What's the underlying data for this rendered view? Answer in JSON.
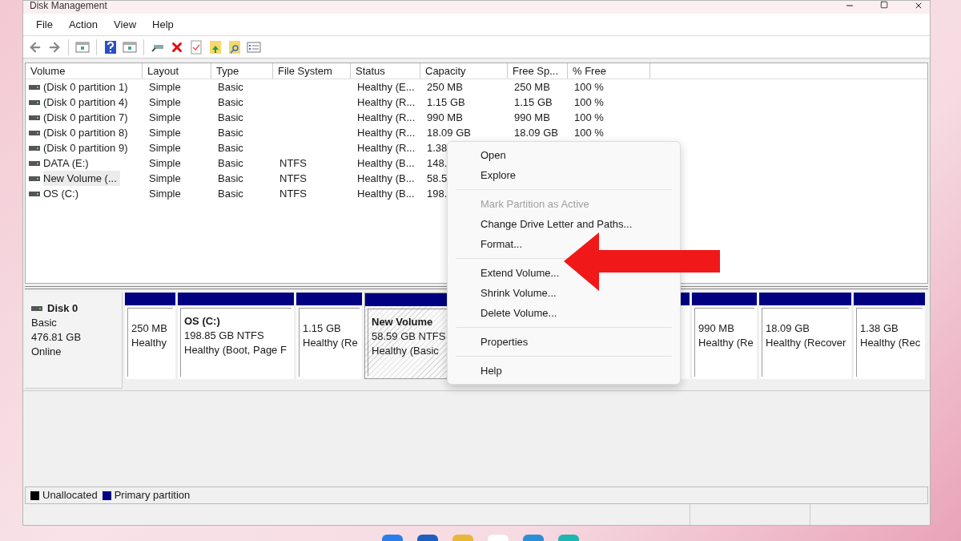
{
  "window": {
    "title": "Disk Management"
  },
  "menubar": [
    "File",
    "Action",
    "View",
    "Help"
  ],
  "table": {
    "columns": [
      "Volume",
      "Layout",
      "Type",
      "File System",
      "Status",
      "Capacity",
      "Free Sp...",
      "% Free"
    ],
    "rows": [
      {
        "selected": false,
        "cells": [
          "(Disk 0 partition 1)",
          "Simple",
          "Basic",
          "",
          "Healthy (E...",
          "250 MB",
          "250 MB",
          "100 %"
        ]
      },
      {
        "selected": false,
        "cells": [
          "(Disk 0 partition 4)",
          "Simple",
          "Basic",
          "",
          "Healthy (R...",
          "1.15 GB",
          "1.15 GB",
          "100 %"
        ]
      },
      {
        "selected": false,
        "cells": [
          "(Disk 0 partition 7)",
          "Simple",
          "Basic",
          "",
          "Healthy (R...",
          "990 MB",
          "990 MB",
          "100 %"
        ]
      },
      {
        "selected": false,
        "cells": [
          "(Disk 0 partition 8)",
          "Simple",
          "Basic",
          "",
          "Healthy (R...",
          "18.09 GB",
          "18.09 GB",
          "100 %"
        ]
      },
      {
        "selected": false,
        "cells": [
          "(Disk 0 partition 9)",
          "Simple",
          "Basic",
          "",
          "Healthy (R...",
          "1.38"
        ]
      },
      {
        "selected": false,
        "cells": [
          "DATA (E:)",
          "Simple",
          "Basic",
          "NTFS",
          "Healthy (B...",
          "148."
        ]
      },
      {
        "selected": true,
        "cells": [
          "New Volume (...",
          "Simple",
          "Basic",
          "NTFS",
          "Healthy (B...",
          "58.5"
        ]
      },
      {
        "selected": false,
        "cells": [
          "OS (C:)",
          "Simple",
          "Basic",
          "NTFS",
          "Healthy (B...",
          "198."
        ]
      }
    ]
  },
  "disk": {
    "name": "Disk 0",
    "lines": [
      "Basic",
      "476.81 GB",
      "Online"
    ],
    "partitions": [
      {
        "selected": false,
        "lines": [
          "250 MB",
          "Healthy"
        ]
      },
      {
        "selected": false,
        "title": "OS  (C:)",
        "lines": [
          "198.85 GB NTFS",
          "Healthy (Boot, Page F"
        ]
      },
      {
        "selected": false,
        "lines": [
          "1.15 GB",
          "Healthy (Re"
        ]
      },
      {
        "selected": true,
        "title": "New Volume",
        "lines": [
          "58.59 GB NTFS",
          "Healthy (Basic"
        ]
      },
      {
        "kind": "covered"
      },
      {
        "kind": "hidden"
      },
      {
        "selected": false,
        "lines": [
          "990 MB",
          "Healthy (Re"
        ]
      },
      {
        "selected": false,
        "lines": [
          "18.09 GB",
          "Healthy (Recover"
        ]
      },
      {
        "selected": false,
        "lines": [
          "1.38 GB",
          "Healthy (Rec"
        ]
      }
    ]
  },
  "legend": [
    {
      "label": "Unallocated",
      "color": "#000000"
    },
    {
      "label": "Primary partition",
      "color": "#000080"
    }
  ],
  "context_menu": [
    {
      "kind": "item",
      "label": "Open",
      "disabled": false
    },
    {
      "kind": "item",
      "label": "Explore",
      "disabled": false
    },
    {
      "kind": "separator"
    },
    {
      "kind": "item",
      "label": "Mark Partition as Active",
      "disabled": true
    },
    {
      "kind": "item",
      "label": "Change Drive Letter and Paths...",
      "disabled": false
    },
    {
      "kind": "item",
      "label": "Format...",
      "disabled": false
    },
    {
      "kind": "separator"
    },
    {
      "kind": "item",
      "label": "Extend Volume...",
      "disabled": false
    },
    {
      "kind": "item",
      "label": "Shrink Volume...",
      "disabled": false
    },
    {
      "kind": "item",
      "label": "Delete Volume...",
      "disabled": false
    },
    {
      "kind": "separator"
    },
    {
      "kind": "item",
      "label": "Properties",
      "disabled": false
    },
    {
      "kind": "separator"
    },
    {
      "kind": "item",
      "label": "Help",
      "disabled": false
    }
  ]
}
